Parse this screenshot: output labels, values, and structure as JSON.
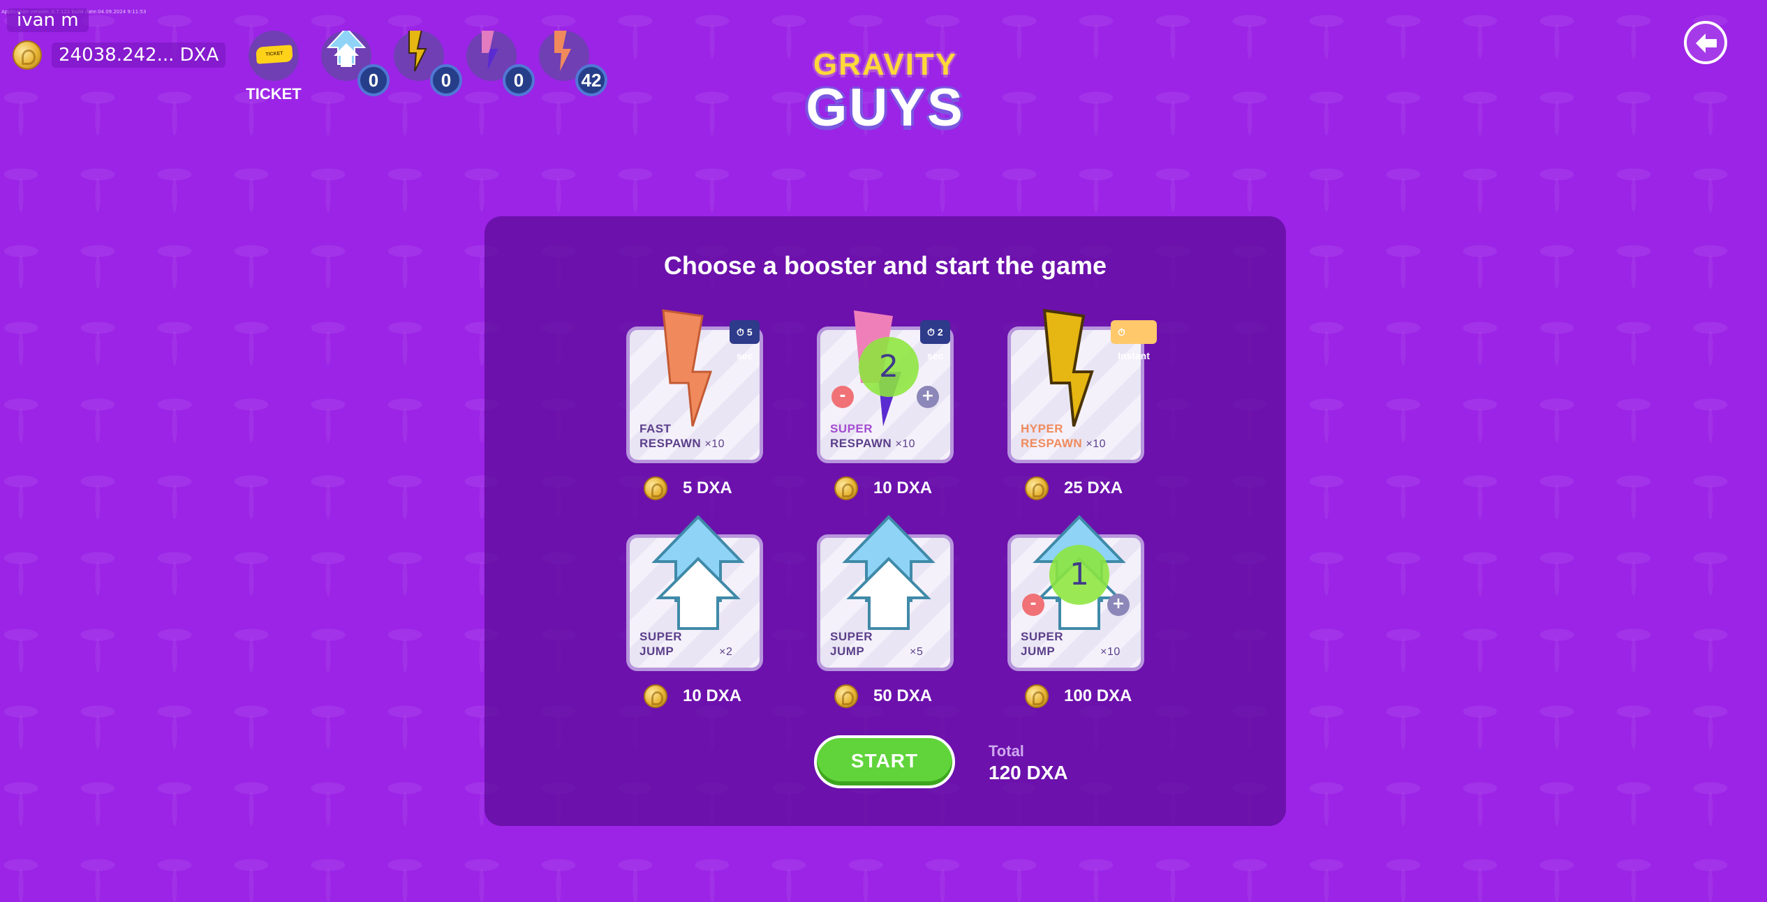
{
  "app": {
    "version_text": "Application version: 0.7.122 build date:04.09.2024 9:11:53",
    "username": "ivan m",
    "balance": "24038.242... DXA"
  },
  "hud": {
    "ticket_label": "TICKET",
    "ticket_badge": "TICKET",
    "items": [
      {
        "icon": "super-jump-arrow-icon",
        "count": "0"
      },
      {
        "icon": "hyper-respawn-bolt-icon",
        "count": "0"
      },
      {
        "icon": "super-respawn-bolt-icon",
        "count": "0"
      },
      {
        "icon": "fast-respawn-bolt-icon",
        "count": "42"
      }
    ]
  },
  "logo": {
    "top": "GRAVITY",
    "bottom": "GUYS"
  },
  "panel": {
    "title": "Choose a booster and start the game",
    "boosters": [
      {
        "line1": "FAST",
        "line2": "RESPAWN",
        "qty": "×10",
        "tag": "5 sec",
        "price": "5 DXA",
        "icon": "fast-respawn-bolt-icon"
      },
      {
        "line1": "SUPER",
        "line2": "RESPAWN",
        "qty": "×10",
        "tag": "2 sec",
        "price": "10 DXA",
        "icon": "super-respawn-bolt-icon",
        "selected": "2"
      },
      {
        "line1": "HYPER",
        "line2": "RESPAWN",
        "qty": "×10",
        "tag": "Instant",
        "price": "25 DXA",
        "icon": "hyper-respawn-bolt-icon"
      },
      {
        "line1": "SUPER",
        "line2": "JUMP",
        "qty": "×2",
        "price": "10 DXA",
        "icon": "super-jump-arrow-icon"
      },
      {
        "line1": "SUPER",
        "line2": "JUMP",
        "qty": "×5",
        "price": "50 DXA",
        "icon": "super-jump-arrow-icon"
      },
      {
        "line1": "SUPER",
        "line2": "JUMP",
        "qty": "×10",
        "price": "100 DXA",
        "icon": "super-jump-arrow-icon",
        "selected": "1"
      }
    ],
    "start_label": "START",
    "total_label": "Total",
    "total_value": "120 DXA",
    "minus": "-",
    "plus": "+"
  },
  "colors": {
    "background": "#9b24e6",
    "panel": "#5a0a96",
    "start_green": "#60d43a",
    "selection_green": "#8ce63c"
  }
}
